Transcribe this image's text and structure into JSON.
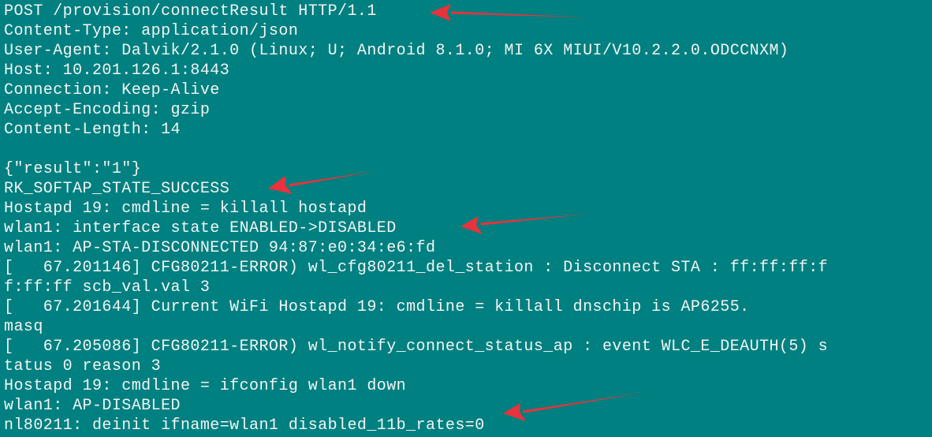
{
  "terminal": {
    "background": "#008080",
    "text_color": "#f4f4f4",
    "annotation_color": "#e8323c",
    "lines": [
      "POST /provision/connectResult HTTP/1.1",
      "Content-Type: application/json",
      "User-Agent: Dalvik/2.1.0 (Linux; U; Android 8.1.0; MI 6X MIUI/V10.2.2.0.ODCCNXM)",
      "Host: 10.201.126.1:8443",
      "Connection: Keep-Alive",
      "Accept-Encoding: gzip",
      "Content-Length: 14",
      "",
      "{\"result\":\"1\"}",
      "RK_SOFTAP_STATE_SUCCESS",
      "Hostapd 19: cmdline = killall hostapd",
      "wlan1: interface state ENABLED->DISABLED",
      "wlan1: AP-STA-DISCONNECTED 94:87:e0:34:e6:fd",
      "[   67.201146] CFG80211-ERROR) wl_cfg80211_del_station : Disconnect STA : ff:ff:ff:f",
      "f:ff:ff scb_val.val 3",
      "[   67.201644] Current WiFi Hostapd 19: cmdline = killall dnschip is AP6255.",
      "masq",
      "[   67.205086] CFG80211-ERROR) wl_notify_connect_status_ap : event WLC_E_DEAUTH(5) s",
      "tatus 0 reason 3",
      "Hostapd 19: cmdline = ifconfig wlan1 down",
      "wlan1: AP-DISABLED",
      "nl80211: deinit ifname=wlan1 disabled_11b_rates=0"
    ]
  }
}
